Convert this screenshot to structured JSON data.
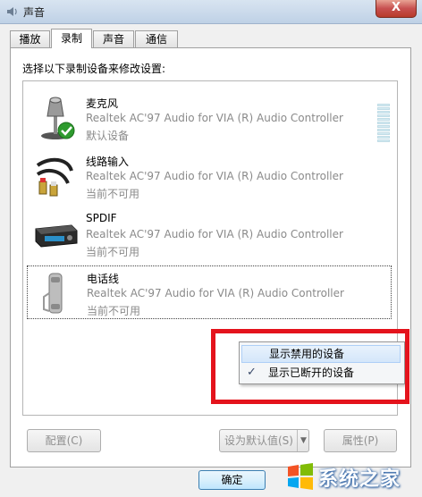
{
  "window": {
    "title": "声音",
    "close_label": "X"
  },
  "tabs": [
    {
      "label": "播放",
      "active": false
    },
    {
      "label": "录制",
      "active": true
    },
    {
      "label": "声音",
      "active": false
    },
    {
      "label": "通信",
      "active": false
    }
  ],
  "instruction": "选择以下录制设备来修改设置:",
  "devices": [
    {
      "name": "麦克风",
      "description": "Realtek AC'97 Audio for VIA (R) Audio Controller",
      "status": "默认设备",
      "icon": "microphone-icon",
      "is_default": true
    },
    {
      "name": "线路输入",
      "description": "Realtek AC'97 Audio for VIA (R) Audio Controller",
      "status": "当前不可用",
      "icon": "rca-cable-icon"
    },
    {
      "name": "SPDIF",
      "description": "Realtek AC'97 Audio for VIA (R) Audio Controller",
      "status": "当前不可用",
      "icon": "spdif-device-icon"
    },
    {
      "name": "电话线",
      "description": "Realtek AC'97 Audio for VIA (R) Audio Controller",
      "status": "当前不可用",
      "icon": "telephone-handset-icon",
      "selected": true
    }
  ],
  "context_menu": {
    "items": [
      {
        "label": "显示禁用的设备",
        "checked": false,
        "highlighted": true
      },
      {
        "label": "显示已断开的设备",
        "checked": true,
        "check_mark": "✓"
      }
    ]
  },
  "buttons": {
    "configure": "配置(C)",
    "set_default": "设为默认值(S)",
    "properties": "属性(P)",
    "ok": "确定"
  },
  "watermark": {
    "text": "系统之家"
  },
  "colors": {
    "annotation_box": "#e4131c",
    "disabled_text": "#8a8a8a"
  }
}
